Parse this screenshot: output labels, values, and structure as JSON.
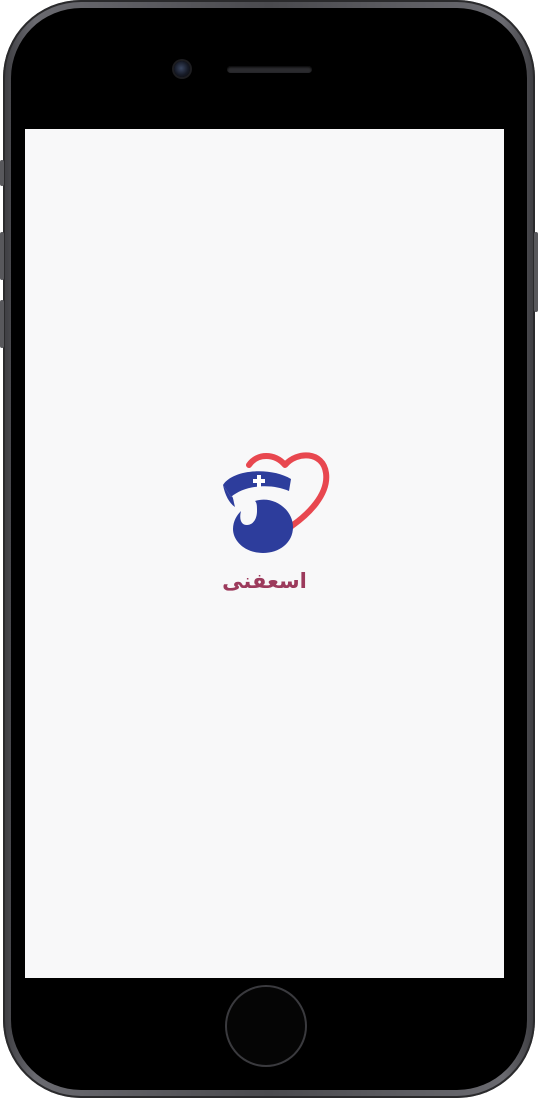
{
  "app": {
    "name": "اسعفنى"
  },
  "icons": {
    "logo": "nurse-heart-logo-icon",
    "camera": "front-camera-icon",
    "home": "home-button-icon"
  },
  "colors": {
    "heart": "#e8474f",
    "nurse": "#2d3d9c",
    "app_name": "#9c3a5c",
    "screen_background": "#f8f8f9",
    "device_body": "#4a4a4e"
  }
}
